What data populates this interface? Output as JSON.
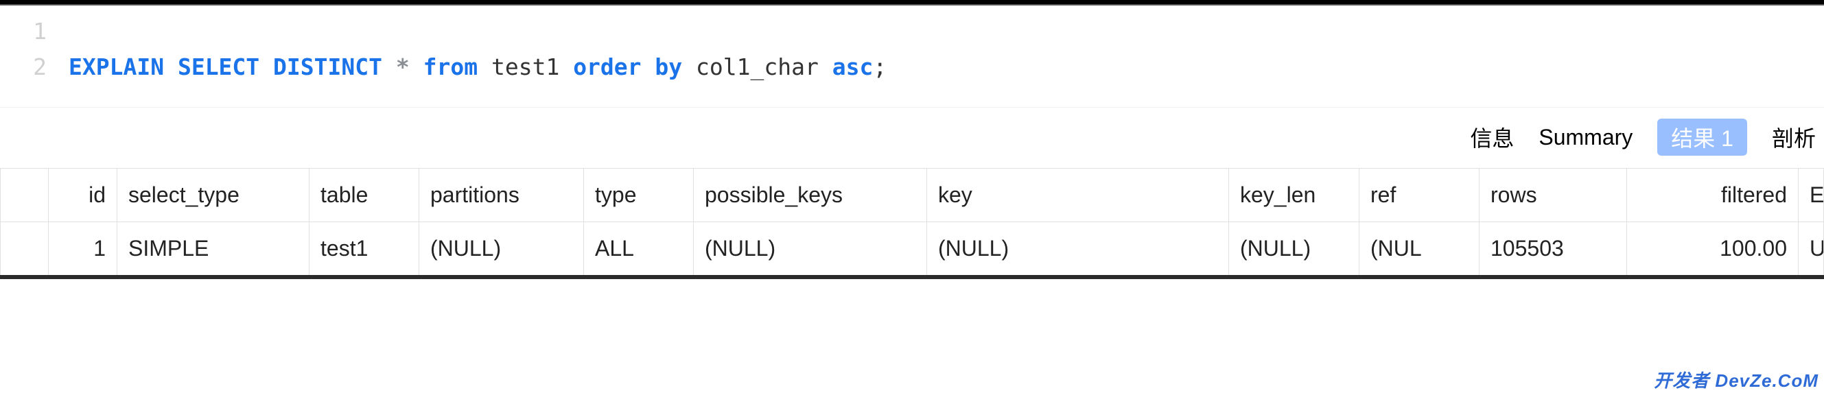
{
  "editor": {
    "lines": [
      {
        "number": "1",
        "tokens": []
      },
      {
        "number": "2",
        "tokens": [
          {
            "text": "EXPLAIN",
            "cls": "kw-blue"
          },
          {
            "text": " ",
            "cls": "plain"
          },
          {
            "text": "SELECT",
            "cls": "kw-blue"
          },
          {
            "text": " ",
            "cls": "plain"
          },
          {
            "text": "DISTINCT",
            "cls": "kw-blue"
          },
          {
            "text": " ",
            "cls": "plain"
          },
          {
            "text": "*",
            "cls": "kw-gray"
          },
          {
            "text": " ",
            "cls": "plain"
          },
          {
            "text": "from",
            "cls": "kw-blue"
          },
          {
            "text": " test1 ",
            "cls": "plain"
          },
          {
            "text": "order",
            "cls": "kw-blue"
          },
          {
            "text": " ",
            "cls": "plain"
          },
          {
            "text": "by",
            "cls": "kw-blue"
          },
          {
            "text": " col1_char ",
            "cls": "plain"
          },
          {
            "text": "asc",
            "cls": "kw-blue"
          },
          {
            "text": ";",
            "cls": "plain"
          }
        ]
      }
    ]
  },
  "tabs": {
    "items": [
      {
        "label": "信息",
        "active": false
      },
      {
        "label": "Summary",
        "active": false
      },
      {
        "label": "结果 1",
        "active": true
      },
      {
        "label": "剖析",
        "active": false
      }
    ]
  },
  "results": {
    "columns": [
      {
        "key": "marker",
        "label": "",
        "cls": "col-marker"
      },
      {
        "key": "id",
        "label": "id",
        "cls": "col-id"
      },
      {
        "key": "select_type",
        "label": "select_type",
        "cls": "col-select-type"
      },
      {
        "key": "table",
        "label": "table",
        "cls": "col-table"
      },
      {
        "key": "partitions",
        "label": "partitions",
        "cls": "col-partitions"
      },
      {
        "key": "type",
        "label": "type",
        "cls": "col-type"
      },
      {
        "key": "possible_keys",
        "label": "possible_keys",
        "cls": "col-possible-keys"
      },
      {
        "key": "key",
        "label": "key",
        "cls": "col-key"
      },
      {
        "key": "key_len",
        "label": "key_len",
        "cls": "col-key-len"
      },
      {
        "key": "ref",
        "label": "ref",
        "cls": "col-ref"
      },
      {
        "key": "rows",
        "label": "rows",
        "cls": "col-rows"
      },
      {
        "key": "filtered",
        "label": "filtered",
        "cls": "col-filtered"
      },
      {
        "key": "extra",
        "label": "Extra",
        "cls": "col-extra"
      }
    ],
    "rows": [
      {
        "marker": "",
        "id": "1",
        "select_type": "SIMPLE",
        "table": "test1",
        "partitions": {
          "value": "(NULL)",
          "null": true
        },
        "type": "ALL",
        "possible_keys": {
          "value": "(NULL)",
          "null": true
        },
        "key": {
          "value": "(NULL)",
          "null": true
        },
        "key_len": {
          "value": "(NULL)",
          "null": true
        },
        "ref": {
          "value": "(NUL",
          "null": true
        },
        "rows": "105503",
        "filtered": "100.00",
        "extra": "Using"
      }
    ]
  },
  "watermark": "开发者 DevZe.CoM"
}
